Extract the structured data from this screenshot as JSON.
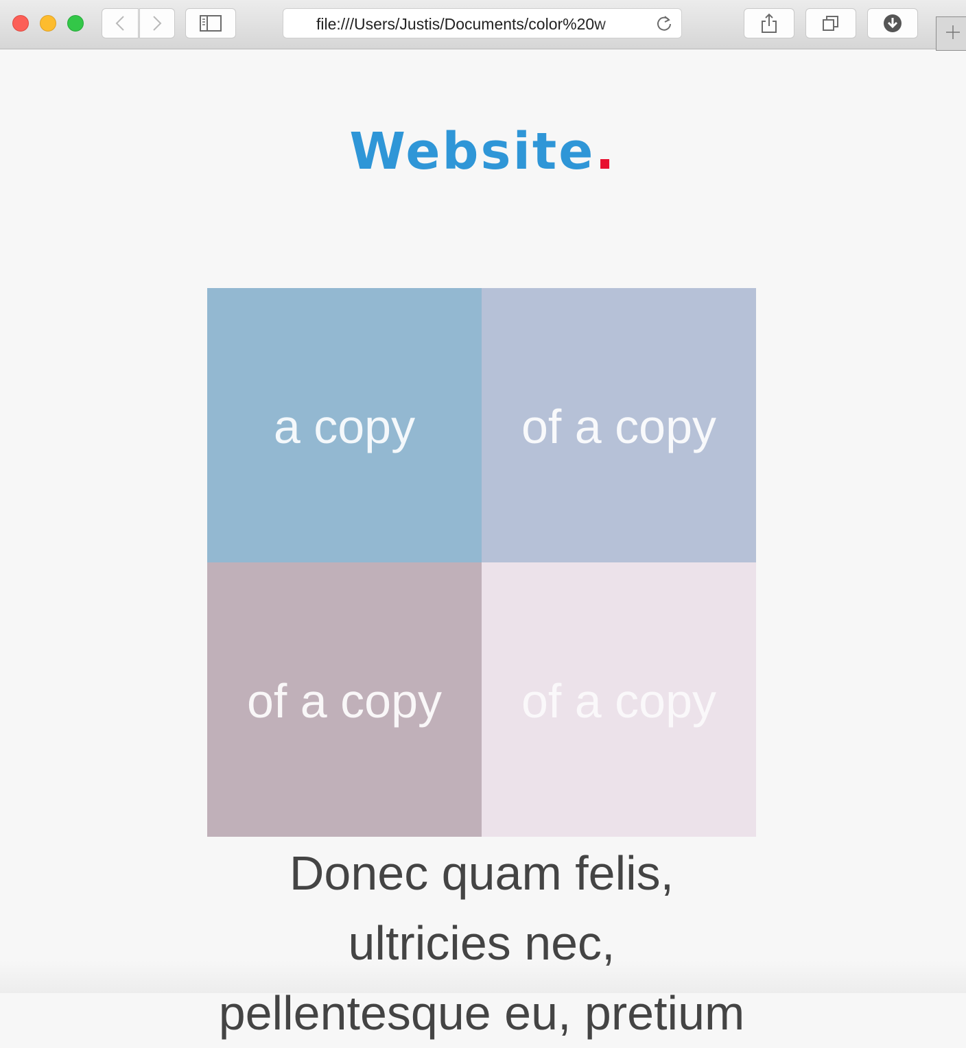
{
  "browser": {
    "url": "file:///Users/Justis/Documents/color%20w",
    "icons": {
      "back": "chevron-left-icon",
      "forward": "chevron-right-icon",
      "sidebar": "sidebar-icon",
      "reload": "reload-icon",
      "share": "share-icon",
      "tabs": "tabs-icon",
      "download": "download-icon",
      "new_tab": "plus-icon"
    }
  },
  "page": {
    "title": "Website",
    "title_dot": ".",
    "title_color": "#2f96d7",
    "dot_color": "#e8102f",
    "tiles": [
      {
        "label": "a copy",
        "color": "#93b8d1"
      },
      {
        "label": "of a copy",
        "color": "#b6c1d7"
      },
      {
        "label": "of a copy",
        "color": "#c0b0b9"
      },
      {
        "label": "of a copy",
        "color": "#ece2ea"
      }
    ],
    "body_text": "Donec quam felis, ultricies nec, pellentesque eu, pretium"
  }
}
